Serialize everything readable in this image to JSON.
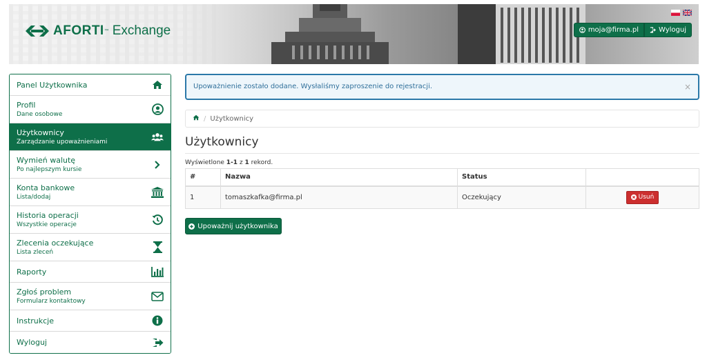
{
  "header": {
    "brand": "AFORTI",
    "brand_tm": "™",
    "brand_sub": "Exchange",
    "account_label": "moja@firma.pl",
    "logout_label": "Wyloguj",
    "accent_color": "#0e6f49"
  },
  "sidebar": {
    "items": [
      {
        "label": "Panel Użytkownika",
        "sub": "",
        "icon": "home-icon"
      },
      {
        "label": "Profil",
        "sub": "Dane osobowe",
        "icon": "user-circle-icon"
      },
      {
        "label": "Użytkownicy",
        "sub": "Zarządzanie upoważnieniami",
        "icon": "users-icon"
      },
      {
        "label": "Wymień walutę",
        "sub": "Po najlepszym kursie",
        "icon": "chevron-right-icon"
      },
      {
        "label": "Konta bankowe",
        "sub": "Lista/dodaj",
        "icon": "bank-icon"
      },
      {
        "label": "Historia operacji",
        "sub": "Wszystkie operacje",
        "icon": "history-icon"
      },
      {
        "label": "Zlecenia oczekujące",
        "sub": "Lista zleceń",
        "icon": "hourglass-icon"
      },
      {
        "label": "Raporty",
        "sub": "",
        "icon": "bar-chart-icon"
      },
      {
        "label": "Zgłoś problem",
        "sub": "Formularz kontaktowy",
        "icon": "envelope-icon"
      },
      {
        "label": "Instrukcje",
        "sub": "",
        "icon": "info-icon"
      },
      {
        "label": "Wyloguj",
        "sub": "",
        "icon": "sign-out-icon"
      }
    ],
    "active_index": 2
  },
  "alert": {
    "message": "Upoważnienie zostało dodane. Wysłaliśmy zaproszenie do rejestracji.",
    "close": "×"
  },
  "breadcrumb": {
    "current": "Użytkownicy",
    "separator": "/"
  },
  "page": {
    "title": "Użytkownicy",
    "records_prefix": "Wyświetlone ",
    "records_range": "1-1",
    "records_mid": " z ",
    "records_total": "1",
    "records_suffix": " rekord."
  },
  "table": {
    "headers": [
      "#",
      "Nazwa",
      "Status",
      ""
    ],
    "rows": [
      {
        "num": "1",
        "name": "tomaszkafka@firma.pl",
        "status": "Oczekujący",
        "action": "Usuń"
      }
    ]
  },
  "add_button": "Upoważnij użytkownika"
}
